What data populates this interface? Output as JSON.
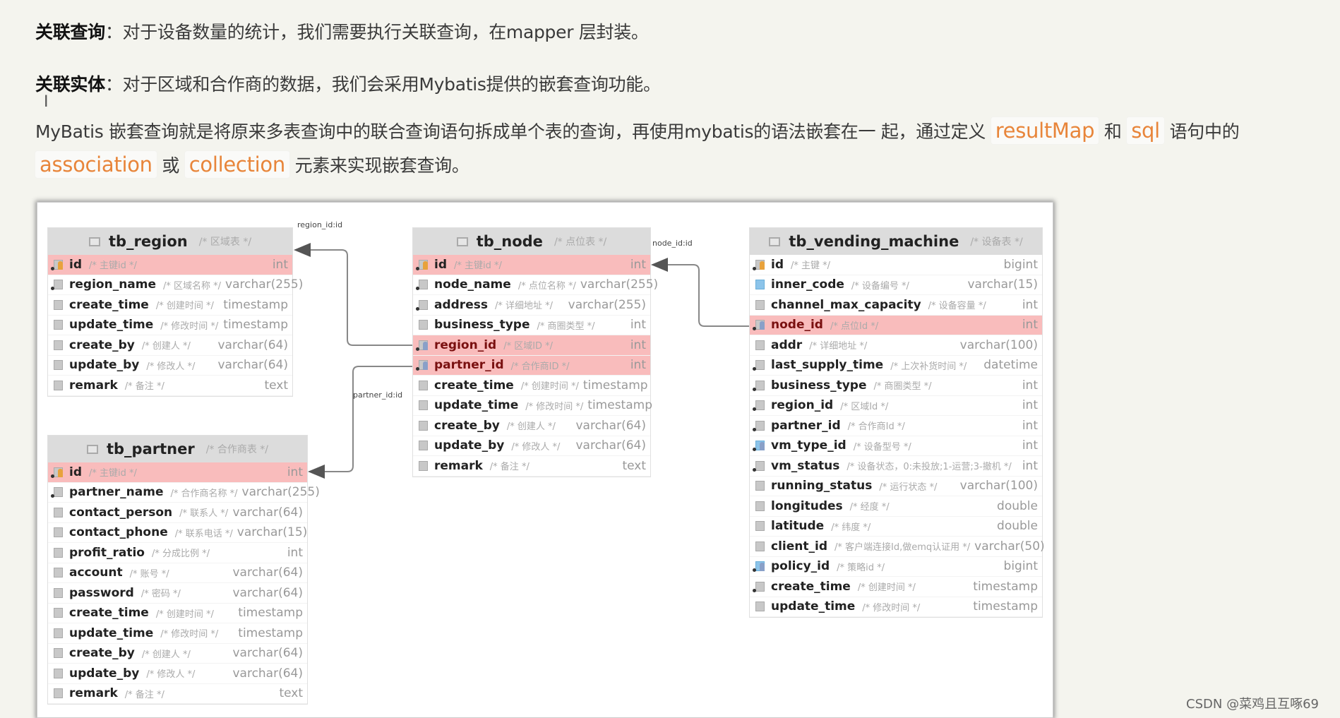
{
  "paragraphs": {
    "p1": {
      "bold": "关联查询",
      "text": "：对于设备数量的统计，我们需要执行关联查询，在mapper 层封装。"
    },
    "p2": {
      "bold": "关联实体",
      "text": "：对于区域和合作商的数据，我们会采用Mybatis提供的嵌套查询功能。"
    },
    "p3": {
      "line1_text": "MyBatis 嵌套查询就是将原来多表查询中的联合查询语句拆成单个表的查询，再使用mybatis的语法嵌套在一 起，通过定义",
      "kw1": "resultMap",
      "mid1": "和",
      "kw2": "sql",
      "line1_end": "语句中的",
      "kw3": "association",
      "mid2": "或",
      "kw4": "collection",
      "line2_end": "元素来实现嵌套查询。"
    }
  },
  "diagram": {
    "tables": {
      "region": {
        "name": "tb_region",
        "comment": "/* 区域表 */",
        "columns": [
          {
            "name": "id",
            "comment": "/* 主键id */",
            "type": "int",
            "icon": "primary-key-icon",
            "highlight": true,
            "pk": true
          },
          {
            "name": "region_name",
            "comment": "/* 区域名称 */",
            "type": "varchar(255)",
            "icon": "column-notnull-icon"
          },
          {
            "name": "create_time",
            "comment": "/* 创建时间 */",
            "type": "timestamp",
            "icon": "column-icon"
          },
          {
            "name": "update_time",
            "comment": "/* 修改时间 */",
            "type": "timestamp",
            "icon": "column-icon"
          },
          {
            "name": "create_by",
            "comment": "/* 创建人 */",
            "type": "varchar(64)",
            "icon": "column-icon"
          },
          {
            "name": "update_by",
            "comment": "/* 修改人 */",
            "type": "varchar(64)",
            "icon": "column-icon"
          },
          {
            "name": "remark",
            "comment": "/* 备注 */",
            "type": "text",
            "icon": "column-icon"
          }
        ]
      },
      "partner": {
        "name": "tb_partner",
        "comment": "/* 合作商表 */",
        "columns": [
          {
            "name": "id",
            "comment": "/* 主键id */",
            "type": "int",
            "icon": "primary-key-icon",
            "highlight": true,
            "pk": true
          },
          {
            "name": "partner_name",
            "comment": "/* 合作商名称 */",
            "type": "varchar(255)",
            "icon": "column-notnull-icon"
          },
          {
            "name": "contact_person",
            "comment": "/* 联系人 */",
            "type": "varchar(64)",
            "icon": "column-icon"
          },
          {
            "name": "contact_phone",
            "comment": "/* 联系电话 */",
            "type": "varchar(15)",
            "icon": "column-icon"
          },
          {
            "name": "profit_ratio",
            "comment": "/* 分成比例 */",
            "type": "int",
            "icon": "column-icon"
          },
          {
            "name": "account",
            "comment": "/* 账号 */",
            "type": "varchar(64)",
            "icon": "column-icon"
          },
          {
            "name": "password",
            "comment": "/* 密码 */",
            "type": "varchar(64)",
            "icon": "column-icon"
          },
          {
            "name": "create_time",
            "comment": "/* 创建时间 */",
            "type": "timestamp",
            "icon": "column-icon"
          },
          {
            "name": "update_time",
            "comment": "/* 修改时间 */",
            "type": "timestamp",
            "icon": "column-icon"
          },
          {
            "name": "create_by",
            "comment": "/* 创建人 */",
            "type": "varchar(64)",
            "icon": "column-icon"
          },
          {
            "name": "update_by",
            "comment": "/* 修改人 */",
            "type": "varchar(64)",
            "icon": "column-icon"
          },
          {
            "name": "remark",
            "comment": "/* 备注 */",
            "type": "text",
            "icon": "column-icon"
          }
        ]
      },
      "node": {
        "name": "tb_node",
        "comment": "/* 点位表 */",
        "columns": [
          {
            "name": "id",
            "comment": "/* 主键id */",
            "type": "int",
            "icon": "primary-key-icon",
            "highlight": true,
            "pk": true
          },
          {
            "name": "node_name",
            "comment": "/* 点位名称 */",
            "type": "varchar(255)",
            "icon": "column-notnull-icon"
          },
          {
            "name": "address",
            "comment": "/* 详细地址 */",
            "type": "varchar(255)",
            "icon": "column-notnull-icon"
          },
          {
            "name": "business_type",
            "comment": "/* 商圈类型 */",
            "type": "int",
            "icon": "column-icon"
          },
          {
            "name": "region_id",
            "comment": "/* 区域ID */",
            "type": "int",
            "icon": "foreign-key-icon",
            "highlight": true
          },
          {
            "name": "partner_id",
            "comment": "/* 合作商ID */",
            "type": "int",
            "icon": "foreign-key-icon",
            "highlight": true
          },
          {
            "name": "create_time",
            "comment": "/* 创建时间 */",
            "type": "timestamp",
            "icon": "column-icon"
          },
          {
            "name": "update_time",
            "comment": "/* 修改时间 */",
            "type": "timestamp",
            "icon": "column-icon"
          },
          {
            "name": "create_by",
            "comment": "/* 创建人 */",
            "type": "varchar(64)",
            "icon": "column-icon"
          },
          {
            "name": "update_by",
            "comment": "/* 修改人 */",
            "type": "varchar(64)",
            "icon": "column-icon"
          },
          {
            "name": "remark",
            "comment": "/* 备注 */",
            "type": "text",
            "icon": "column-icon"
          }
        ]
      },
      "vending": {
        "name": "tb_vending_machine",
        "comment": "/* 设备表 */",
        "columns": [
          {
            "name": "id",
            "comment": "/* 主键 */",
            "type": "bigint",
            "icon": "primary-key-icon"
          },
          {
            "name": "inner_code",
            "comment": "/* 设备编号 */",
            "type": "varchar(15)",
            "icon": "index-column-icon"
          },
          {
            "name": "channel_max_capacity",
            "comment": "/* 设备容量 */",
            "type": "int",
            "icon": "column-icon"
          },
          {
            "name": "node_id",
            "comment": "/* 点位Id */",
            "type": "int",
            "icon": "foreign-key-icon",
            "highlight": true
          },
          {
            "name": "addr",
            "comment": "/* 详细地址 */",
            "type": "varchar(100)",
            "icon": "column-icon"
          },
          {
            "name": "last_supply_time",
            "comment": "/* 上次补货时间 */",
            "type": "datetime",
            "icon": "column-notnull-icon"
          },
          {
            "name": "business_type",
            "comment": "/* 商圈类型 */",
            "type": "int",
            "icon": "column-notnull-icon"
          },
          {
            "name": "region_id",
            "comment": "/* 区域Id */",
            "type": "int",
            "icon": "column-notnull-icon"
          },
          {
            "name": "partner_id",
            "comment": "/* 合作商Id */",
            "type": "int",
            "icon": "column-notnull-icon"
          },
          {
            "name": "vm_type_id",
            "comment": "/* 设备型号 */",
            "type": "int",
            "icon": "index-key-icon"
          },
          {
            "name": "vm_status",
            "comment": "/* 设备状态，0:未投放;1-运营;3-撤机 */",
            "type": "int",
            "icon": "column-notnull-icon"
          },
          {
            "name": "running_status",
            "comment": "/* 运行状态 */",
            "type": "varchar(100)",
            "icon": "column-icon"
          },
          {
            "name": "longitudes",
            "comment": "/* 经度 */",
            "type": "double",
            "icon": "column-icon"
          },
          {
            "name": "latitude",
            "comment": "/* 纬度 */",
            "type": "double",
            "icon": "column-icon"
          },
          {
            "name": "client_id",
            "comment": "/* 客户端连接Id,做emq认证用 */",
            "type": "varchar(50)",
            "icon": "column-icon"
          },
          {
            "name": "policy_id",
            "comment": "/* 策略id */",
            "type": "bigint",
            "icon": "index-key-icon"
          },
          {
            "name": "create_time",
            "comment": "/* 创建时间 */",
            "type": "timestamp",
            "icon": "column-notnull-icon"
          },
          {
            "name": "update_time",
            "comment": "/* 修改时间 */",
            "type": "timestamp",
            "icon": "column-icon"
          }
        ]
      }
    },
    "relations": {
      "r1": "region_id:id",
      "r2": "partner_id:id",
      "r3": "node_id:id"
    }
  },
  "watermark": "CSDN @菜鸡且互啄69",
  "colors": {
    "highlight": "#f9bcbc",
    "keyword": "#e8853a",
    "background": "#f4f4ee"
  }
}
